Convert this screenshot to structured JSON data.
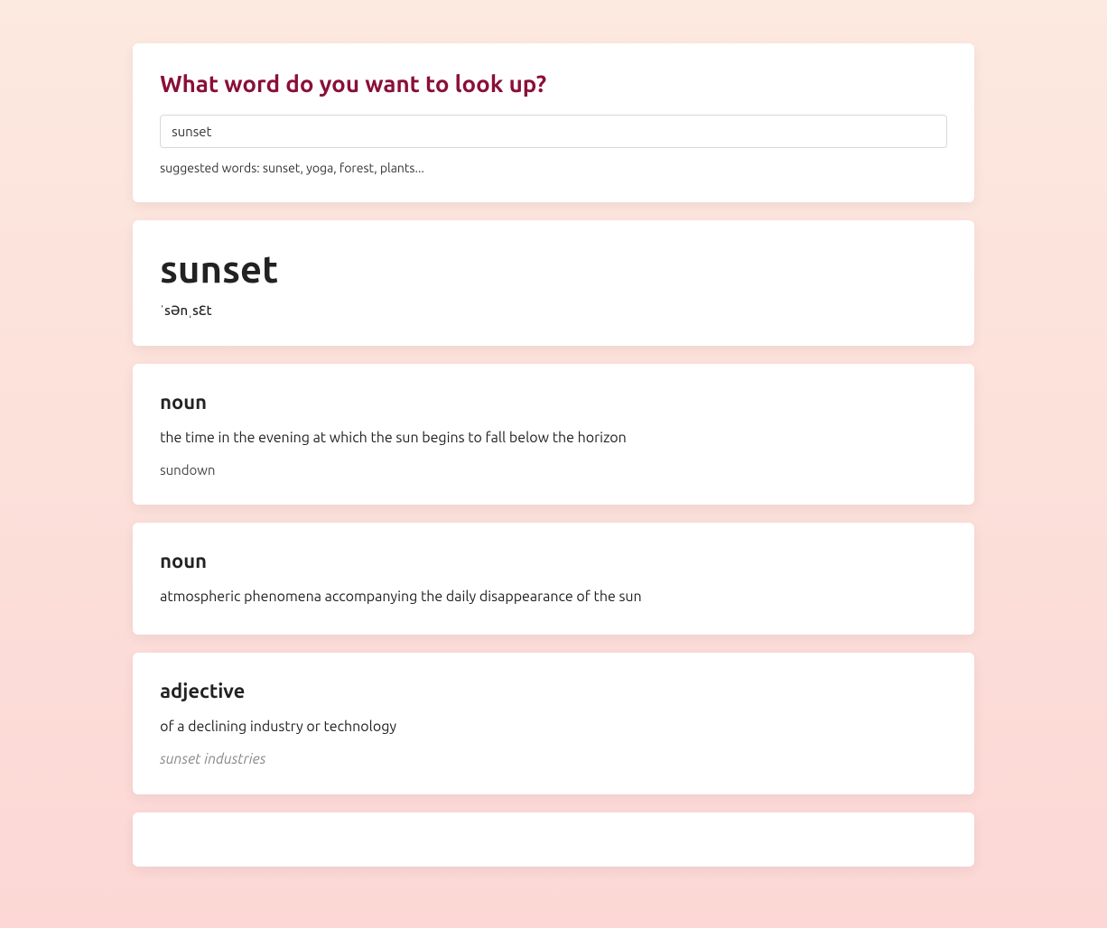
{
  "search": {
    "title": "What word do you want to look up?",
    "value": "sunset",
    "suggestions": "suggested words: sunset, yoga, forest, plants..."
  },
  "result": {
    "word": "sunset",
    "phonetic": "ˈsənˌsɛt"
  },
  "meanings": [
    {
      "pos": "noun",
      "definition": "the time in the evening at which the sun begins to fall below the horizon",
      "synonym": "sundown",
      "example": ""
    },
    {
      "pos": "noun",
      "definition": "atmospheric phenomena accompanying the daily disappearance of the sun",
      "synonym": "",
      "example": ""
    },
    {
      "pos": "adjective",
      "definition": "of a declining industry or technology",
      "synonym": "",
      "example": "sunset industries"
    }
  ]
}
